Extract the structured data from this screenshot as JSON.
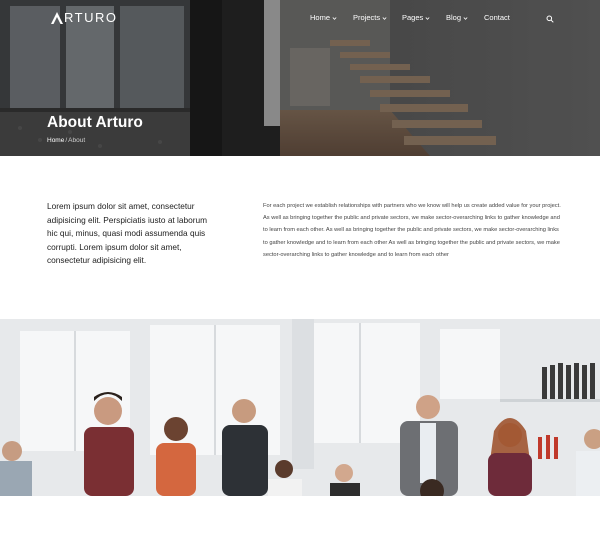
{
  "brand": {
    "logo_text": "RTURO"
  },
  "nav": {
    "items": [
      {
        "label": "Home",
        "has_dropdown": true
      },
      {
        "label": "Projects",
        "has_dropdown": true
      },
      {
        "label": "Pages",
        "has_dropdown": true
      },
      {
        "label": "Blog",
        "has_dropdown": true
      },
      {
        "label": "Contact",
        "has_dropdown": false
      }
    ],
    "search_icon": "search-icon"
  },
  "hero": {
    "title": "About Arturo",
    "breadcrumb": {
      "home": "Home",
      "separator": "/",
      "current": "About"
    }
  },
  "intro": {
    "lead": "Lorem ipsum dolor sit amet, consectetur adipisicing elit. Perspiciatis iusto at laborum hic qui, minus, quasi modi assumenda quis corrupti. Lorem ipsum dolor sit amet, consectetur adipisicing elit.",
    "body": "For each project we establish relationships with partners who we know will help us create added value for your project. As well as bringing together the public and private sectors, we make sector-overarching links to gather knowledge and to learn from each other. As well as bringing together the public and private sectors, we make sector-overarching links to gather knowledge and to learn from each other As well as bringing together the public and private sectors, we make sector-overarching links to gather knowledge and to learn from each other"
  },
  "colors": {
    "hero_overlay": "#2e2e2e",
    "text_dark": "#1d1d1d",
    "text_body": "#444444",
    "background": "#ffffff"
  }
}
